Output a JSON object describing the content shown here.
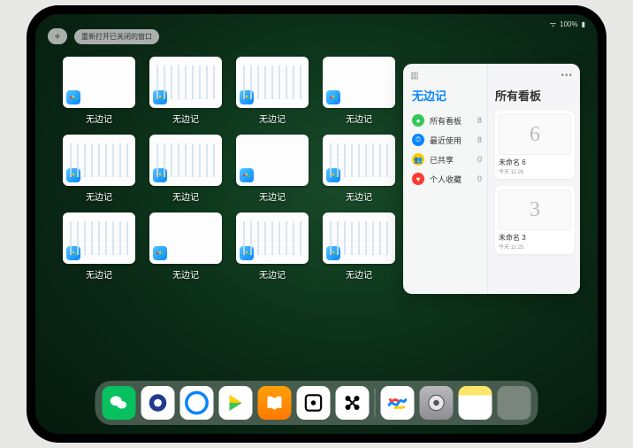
{
  "status": {
    "wifi": "wifi",
    "battery_pct": "100%"
  },
  "top": {
    "plus": "+",
    "reopen_label": "重新打开已关闭的窗口"
  },
  "app_name": "无边记",
  "windows": [
    {
      "label": "无边记",
      "style": "blank"
    },
    {
      "label": "无边记",
      "style": "bars"
    },
    {
      "label": "无边记",
      "style": "bars"
    },
    {
      "label": "无边记",
      "style": "blank"
    },
    {
      "label": "无边记",
      "style": "bars"
    },
    {
      "label": "无边记",
      "style": "bars"
    },
    {
      "label": "无边记",
      "style": "blank"
    },
    {
      "label": "无边记",
      "style": "bars"
    },
    {
      "label": "无边记",
      "style": "bars"
    },
    {
      "label": "无边记",
      "style": "blank"
    },
    {
      "label": "无边记",
      "style": "bars"
    },
    {
      "label": "无边记",
      "style": "bars"
    }
  ],
  "panel": {
    "left_title": "无边记",
    "right_title": "所有看板",
    "nav": [
      {
        "icon": "●",
        "color": "#34c759",
        "label": "所有看板",
        "count": "8"
      },
      {
        "icon": "⏱",
        "color": "#0a84ff",
        "label": "最近使用",
        "count": "8"
      },
      {
        "icon": "👥",
        "color": "#ffcc00",
        "label": "已共享",
        "count": "0"
      },
      {
        "icon": "♥",
        "color": "#ff3b30",
        "label": "个人收藏",
        "count": "0"
      }
    ],
    "boards": [
      {
        "preview": "6",
        "label": "未命名 6",
        "sub": "今天 11:26"
      },
      {
        "preview": "3",
        "label": "未命名 3",
        "sub": "今天 11:25"
      }
    ]
  },
  "dock": [
    {
      "name": "wechat",
      "glyph": "✳"
    },
    {
      "name": "qqhd",
      "glyph": "Q"
    },
    {
      "name": "qqbrowser",
      "glyph": "Q"
    },
    {
      "name": "play",
      "glyph": "▶"
    },
    {
      "name": "books",
      "glyph": "📖"
    },
    {
      "name": "dice",
      "glyph": "⚀"
    },
    {
      "name": "lifx",
      "glyph": "✖"
    },
    {
      "name": "sep"
    },
    {
      "name": "freeform",
      "glyph": "〰"
    },
    {
      "name": "settings",
      "glyph": "⚙"
    },
    {
      "name": "notes",
      "glyph": ""
    },
    {
      "name": "applib"
    }
  ]
}
